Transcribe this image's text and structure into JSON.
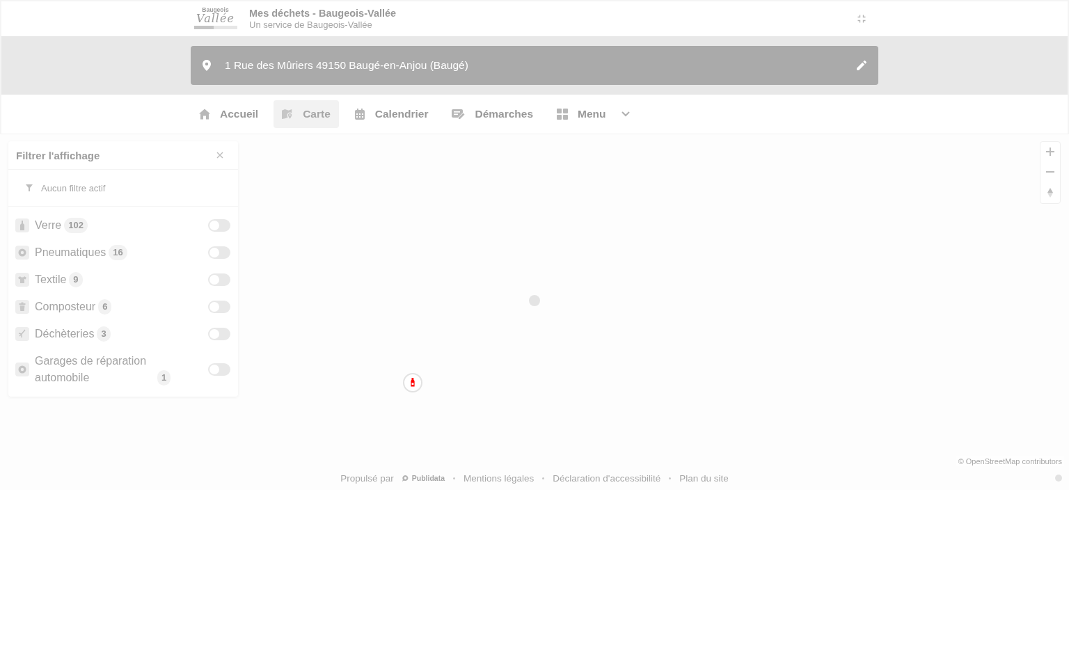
{
  "header": {
    "logo": {
      "line_1": "Baugeois",
      "line_2": "Vallée"
    },
    "title": "Mes déchets - Baugeois-Vallée",
    "subtitle": "Un service de Baugeois-Vallée"
  },
  "address": {
    "value": "1 Rue des Mûriers 49150 Baugé-en-Anjou (Baugé)"
  },
  "nav": [
    {
      "label": "Accueil",
      "kind": "link",
      "selected": false
    },
    {
      "label": "Carte",
      "kind": "link",
      "selected": true
    },
    {
      "label": "Calendrier",
      "kind": "link",
      "selected": false
    },
    {
      "label": "Démarches",
      "kind": "link",
      "selected": false
    },
    {
      "label": "Menu",
      "kind": "dropdown",
      "selected": false
    }
  ],
  "filter_panel": {
    "title": "Filtrer l'affichage",
    "status": "Aucun filtre actif",
    "layers": [
      {
        "name": "Verre",
        "count": "102",
        "on": false
      },
      {
        "name": "Pneumatiques",
        "count": "16",
        "on": false
      },
      {
        "name": "Textile",
        "count": "9",
        "on": false
      },
      {
        "name": "Composteur",
        "count": "6",
        "on": false
      },
      {
        "name": "Déchèteries",
        "count": "3",
        "on": false
      },
      {
        "name": "Garages de réparation automobile",
        "count": "1",
        "on": false
      }
    ]
  },
  "map": {
    "attribution": "© OpenStreetMap contributors"
  },
  "footer": {
    "powered_by": "Propulsé par",
    "brand": "Publidata",
    "links": [
      "Mentions légales",
      "Déclaration d'accessibilité",
      "Plan du site"
    ]
  }
}
